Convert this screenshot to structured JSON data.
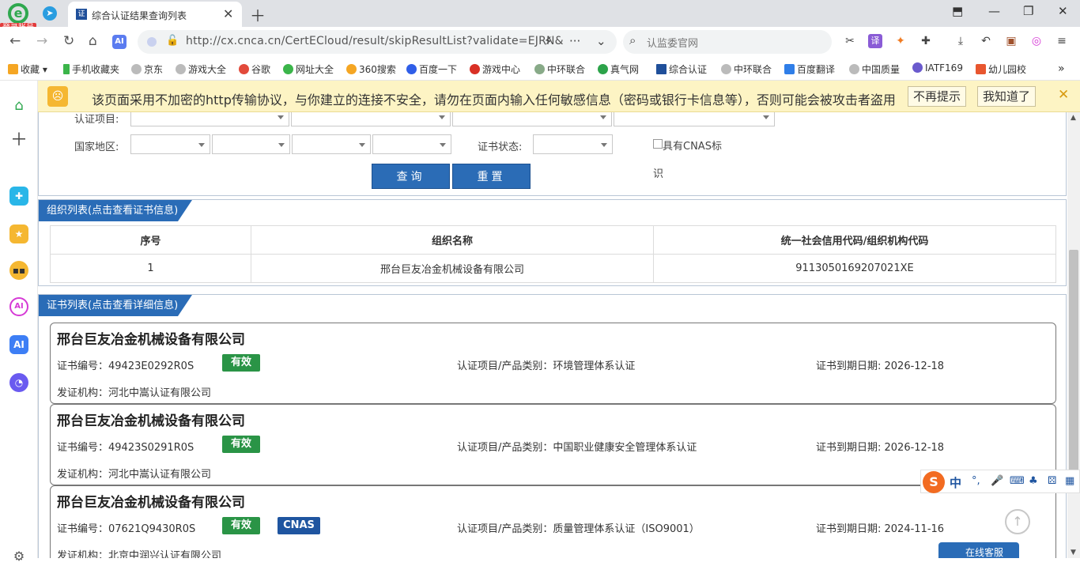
{
  "browser": {
    "account_badge": "登录账号",
    "tab_title": "综合认证结果查询列表",
    "url": "http://cx.cnca.cn/CertECloud/result/skipResultList?validate=EJRN&",
    "search_placeholder": "认监委官网"
  },
  "bookmarks": [
    "收藏",
    "手机收藏夹",
    "京东",
    "游戏大全",
    "谷歌",
    "网址大全",
    "360搜索",
    "百度一下",
    "游戏中心",
    "中环联合",
    "真气网",
    "综合认证",
    "中环联合",
    "百度翻译",
    "中国质量",
    "IATF169",
    "幼儿园校"
  ],
  "warning": {
    "text": "该页面采用不加密的http传输协议，与你建立的连接不安全，请勿在页面内输入任何敏感信息（密码或银行卡信息等），否则可能会被攻击者盗用",
    "dismiss_label": "不再提示",
    "ok_label": "我知道了"
  },
  "filters": {
    "project_label": "认证项目:",
    "region_label": "国家地区:",
    "status_label": "证书状态:",
    "cnas_label": "具有CNAS标",
    "cnas_label_wrap": "识",
    "query_label": "查询",
    "reset_label": "重置"
  },
  "org_section": {
    "title": "组织列表(点击查看证书信息)",
    "headers": [
      "序号",
      "组织名称",
      "统一社会信用代码/组织机构代码"
    ],
    "rows": [
      [
        "1",
        "邢台巨友冶金机械设备有限公司",
        "9113050169207021XE"
      ]
    ]
  },
  "cert_section": {
    "title": "证书列表(点击查看详细信息)",
    "cards": [
      {
        "company": "邢台巨友冶金机械设备有限公司",
        "cert_no": "证书编号：49423E0292R0S",
        "status": "有效",
        "cnas": "",
        "project": "认证项目/产品类别：环境管理体系认证",
        "expiry": "证书到期日期: 2026-12-18",
        "issuer": "发证机构：河北中嵩认证有限公司"
      },
      {
        "company": "邢台巨友冶金机械设备有限公司",
        "cert_no": "证书编号：49423S0291R0S",
        "status": "有效",
        "cnas": "",
        "project": "认证项目/产品类别：中国职业健康安全管理体系认证",
        "expiry": "证书到期日期: 2026-12-18",
        "issuer": "发证机构：河北中嵩认证有限公司"
      },
      {
        "company": "邢台巨友冶金机械设备有限公司",
        "cert_no": "证书编号：07621Q9430R0S",
        "status": "有效",
        "cnas": "CNAS",
        "project": "认证项目/产品类别：质量管理体系认证（ISO9001）",
        "expiry": "证书到期日期: 2024-11-16",
        "issuer": "发证机构：北京中润兴认证有限公司"
      }
    ]
  },
  "widgets": {
    "ime_label": "中",
    "service_label": "在线客服"
  },
  "colors": {
    "primary": "#2a6cb7",
    "valid": "#2a9446",
    "cnas": "#1f55a0",
    "warning_bg": "#fdf4c4"
  }
}
